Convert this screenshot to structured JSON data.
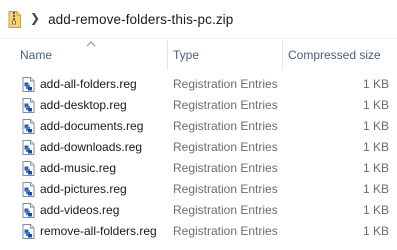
{
  "address_bar": {
    "path_icon": "zip-folder-icon",
    "separator_icon": "chevron-right-icon",
    "path": "add-remove-folders-this-pc.zip"
  },
  "columns": {
    "name": "Name",
    "type": "Type",
    "size": "Compressed size",
    "sort_icon": "sort-ascending-icon"
  },
  "files": [
    {
      "name": "add-all-folders.reg",
      "type": "Registration Entries",
      "size": "1 KB",
      "icon": "reg-file-icon"
    },
    {
      "name": "add-desktop.reg",
      "type": "Registration Entries",
      "size": "1 KB",
      "icon": "reg-file-icon"
    },
    {
      "name": "add-documents.reg",
      "type": "Registration Entries",
      "size": "1 KB",
      "icon": "reg-file-icon"
    },
    {
      "name": "add-downloads.reg",
      "type": "Registration Entries",
      "size": "1 KB",
      "icon": "reg-file-icon"
    },
    {
      "name": "add-music.reg",
      "type": "Registration Entries",
      "size": "1 KB",
      "icon": "reg-file-icon"
    },
    {
      "name": "add-pictures.reg",
      "type": "Registration Entries",
      "size": "1 KB",
      "icon": "reg-file-icon"
    },
    {
      "name": "add-videos.reg",
      "type": "Registration Entries",
      "size": "1 KB",
      "icon": "reg-file-icon"
    },
    {
      "name": "remove-all-folders.reg",
      "type": "Registration Entries",
      "size": "1 KB",
      "icon": "reg-file-icon"
    }
  ],
  "colors": {
    "header_text": "#4c607a",
    "secondary_text": "#6d6d6d",
    "zip_icon": "#e8c25a",
    "reg_icon": "#2a5fb5"
  }
}
